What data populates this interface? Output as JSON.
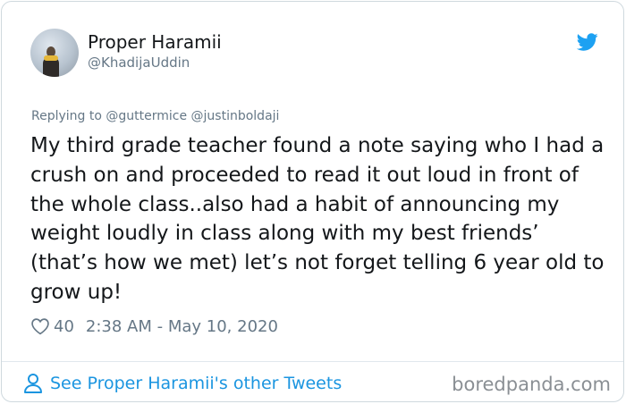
{
  "author": {
    "display_name": "Proper Haramii",
    "handle": "@KhadijaUddin"
  },
  "icons": {
    "brand": "twitter-bird-icon",
    "like": "heart-icon",
    "profile": "person-icon",
    "brand_color": "#1da1f2"
  },
  "tweet": {
    "replying_to": "Replying to @guttermice @justinboldaji",
    "text": "My third grade teacher found a note saying who I had a crush on and proceeded to read it out loud in front of the whole class..also had a habit of announcing my weight loudly in class along with my best friends’ (that’s how we met) let’s not forget telling 6 year old to grow up!",
    "likes": "40",
    "timestamp": "2:38 AM - May 10, 2020"
  },
  "footer": {
    "other_tweets_link": "See Proper Haramii's other Tweets",
    "link_color": "#1b95e0",
    "watermark": "boredpanda.com"
  }
}
